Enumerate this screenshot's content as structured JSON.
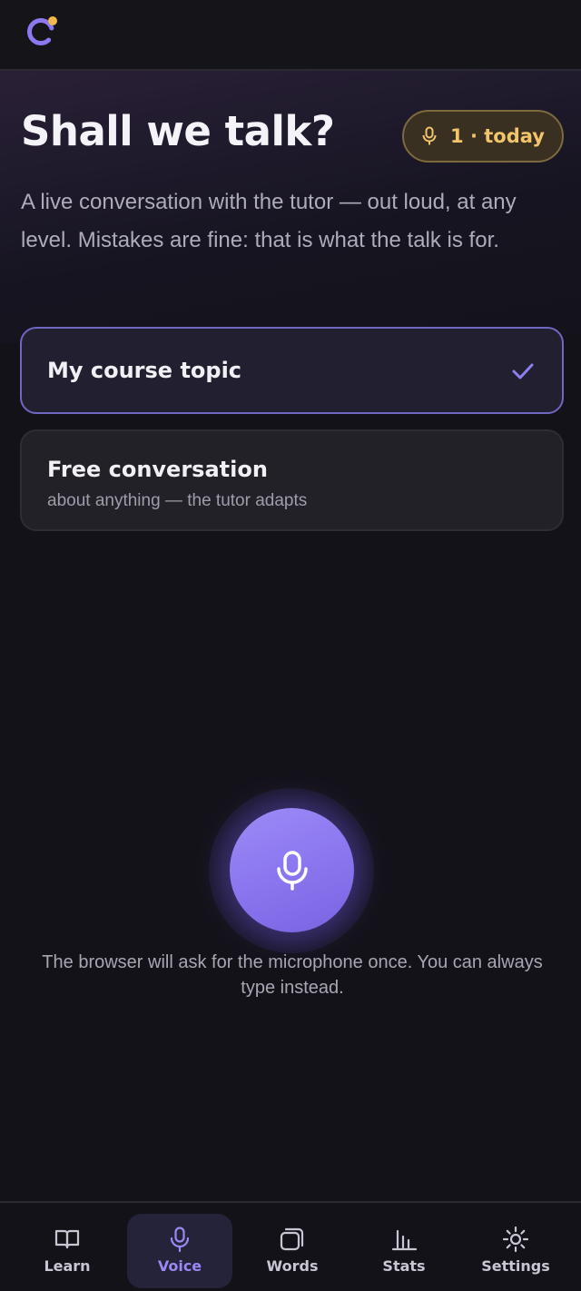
{
  "header": {
    "logo_icon": "app-logo-icon"
  },
  "hero": {
    "title": "Shall we talk?",
    "badge": {
      "icon": "microphone-icon",
      "text": "1 · today",
      "color": "#f2c46b"
    },
    "intro": "A live conversation with the tutor — out loud, at any level. Mistakes are fine: that is what the talk is for."
  },
  "options": [
    {
      "title": "My course topic",
      "selected": true,
      "icon": "check-icon"
    },
    {
      "title": "Free conversation",
      "subtitle": "about anything — the tutor adapts",
      "selected": false
    }
  ],
  "mic": {
    "icon": "microphone-icon",
    "hint": "The browser will ask for the microphone once. You can always type instead."
  },
  "nav": {
    "items": [
      {
        "label": "Learn",
        "icon": "book-icon",
        "active": false
      },
      {
        "label": "Voice",
        "icon": "microphone-icon",
        "active": true
      },
      {
        "label": "Words",
        "icon": "cards-icon",
        "active": false
      },
      {
        "label": "Stats",
        "icon": "bar-chart-icon",
        "active": false
      },
      {
        "label": "Settings",
        "icon": "gear-icon",
        "active": false
      }
    ]
  },
  "colors": {
    "accent": "#8b76f0",
    "badge_text": "#f2c46b",
    "background": "#141219"
  }
}
